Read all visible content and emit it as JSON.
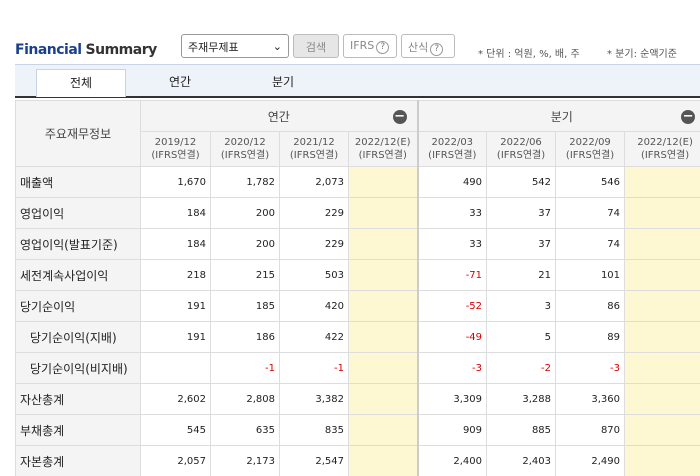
{
  "header": {
    "title_part1": "Financial",
    "title_part2": "Summary",
    "select_value": "주재무제표",
    "search_label": "검색",
    "ifrs_label": "IFRS",
    "calc_label": "산식",
    "help_glyph": "?",
    "unit_text": "* 단위 : 억원, %, 배, 주",
    "quarter_note": "* 분기: 순액기준"
  },
  "tabs": [
    "전체",
    "연간",
    "분기"
  ],
  "table": {
    "row_header": "주요재무정보",
    "group_annual": "연간",
    "group_quarter": "분기",
    "collapse_glyph": "−",
    "columns": [
      {
        "period": "2019/12",
        "basis": "(IFRS연결)"
      },
      {
        "period": "2020/12",
        "basis": "(IFRS연결)"
      },
      {
        "period": "2021/12",
        "basis": "(IFRS연결)"
      },
      {
        "period": "2022/12(E)",
        "basis": "(IFRS연결)"
      },
      {
        "period": "2022/03",
        "basis": "(IFRS연결)"
      },
      {
        "period": "2022/06",
        "basis": "(IFRS연결)"
      },
      {
        "period": "2022/09",
        "basis": "(IFRS연결)"
      },
      {
        "period": "2022/12(E)",
        "basis": "(IFRS연결)"
      }
    ],
    "rows": [
      {
        "label": "매출액",
        "values": [
          "1,670",
          "1,782",
          "2,073",
          "",
          "490",
          "542",
          "546",
          ""
        ]
      },
      {
        "label": "영업이익",
        "values": [
          "184",
          "200",
          "229",
          "",
          "33",
          "37",
          "74",
          ""
        ]
      },
      {
        "label": "영업이익(발표기준)",
        "values": [
          "184",
          "200",
          "229",
          "",
          "33",
          "37",
          "74",
          ""
        ]
      },
      {
        "label": "세전계속사업이익",
        "values": [
          "218",
          "215",
          "503",
          "",
          "-71",
          "21",
          "101",
          ""
        ]
      },
      {
        "label": "당기순이익",
        "values": [
          "191",
          "185",
          "420",
          "",
          "-52",
          "3",
          "86",
          ""
        ]
      },
      {
        "label": "당기순이익(지배)",
        "values": [
          "191",
          "186",
          "422",
          "",
          "-49",
          "5",
          "89",
          ""
        ]
      },
      {
        "label": "당기순이익(비지배)",
        "values": [
          "",
          "-1",
          "-1",
          "",
          "-3",
          "-2",
          "-3",
          ""
        ]
      },
      {
        "label": "자산총계",
        "values": [
          "2,602",
          "2,808",
          "3,382",
          "",
          "3,309",
          "3,288",
          "3,360",
          ""
        ]
      },
      {
        "label": "부채총계",
        "values": [
          "545",
          "635",
          "835",
          "",
          "909",
          "885",
          "870",
          ""
        ]
      },
      {
        "label": "자본총계",
        "values": [
          "2,057",
          "2,173",
          "2,547",
          "",
          "2,400",
          "2,403",
          "2,490",
          ""
        ]
      }
    ]
  }
}
